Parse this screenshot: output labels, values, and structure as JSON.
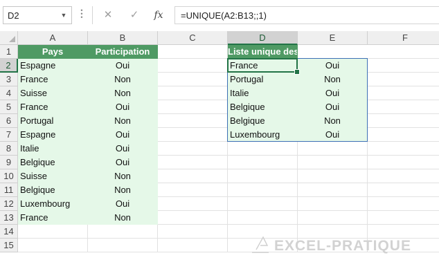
{
  "formula_bar": {
    "name_box": "D2",
    "cancel_icon": "✕",
    "enter_icon": "✓",
    "fx_label": "fx",
    "formula": "=UNIQUE(A2:B13;;1)"
  },
  "columns": [
    "A",
    "B",
    "C",
    "D",
    "E",
    "F"
  ],
  "rows": [
    "1",
    "2",
    "3",
    "4",
    "5",
    "6",
    "7",
    "8",
    "9",
    "10",
    "11",
    "12",
    "13",
    "14",
    "15"
  ],
  "selected_cell": {
    "column": "D",
    "row": "2"
  },
  "table_source": {
    "headers": [
      "Pays",
      "Participation"
    ],
    "rows": [
      [
        "Espagne",
        "Oui"
      ],
      [
        "France",
        "Non"
      ],
      [
        "Suisse",
        "Non"
      ],
      [
        "France",
        "Oui"
      ],
      [
        "Portugal",
        "Non"
      ],
      [
        "Espagne",
        "Oui"
      ],
      [
        "Italie",
        "Oui"
      ],
      [
        "Belgique",
        "Oui"
      ],
      [
        "Suisse",
        "Non"
      ],
      [
        "Belgique",
        "Non"
      ],
      [
        "Luxembourg",
        "Oui"
      ],
      [
        "France",
        "Non"
      ]
    ]
  },
  "table_unique": {
    "header": "Liste unique des choix",
    "rows": [
      [
        "France",
        "Oui"
      ],
      [
        "Portugal",
        "Non"
      ],
      [
        "Italie",
        "Oui"
      ],
      [
        "Belgique",
        "Oui"
      ],
      [
        "Belgique",
        "Non"
      ],
      [
        "Luxembourg",
        "Oui"
      ]
    ]
  },
  "watermark": "EXCEL-PRATIQUE",
  "colors": {
    "header_green": "#4f9a64",
    "light_green": "#e5f8e8",
    "selection_green": "#217346",
    "outline_blue": "#3c6fb5"
  }
}
